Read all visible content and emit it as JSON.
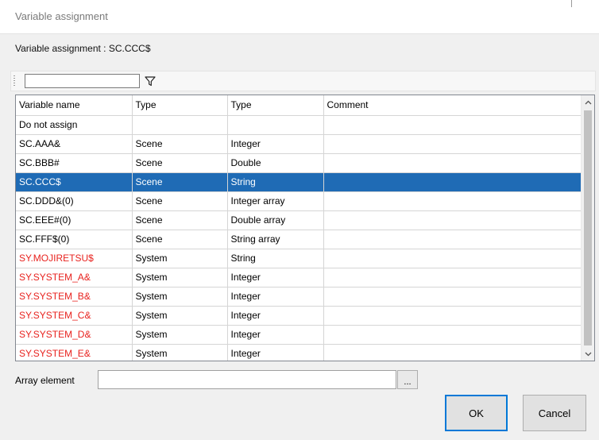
{
  "window": {
    "title": "Variable assignment"
  },
  "assignment": {
    "label": "Variable assignment : SC.CCC$"
  },
  "filter": {
    "value": "",
    "icon": "filter-icon"
  },
  "grid": {
    "columns": [
      "Variable name",
      "Type",
      "Type",
      "Comment"
    ],
    "rows": [
      {
        "name": "Do not assign",
        "scope": "",
        "type": "",
        "comment": ""
      },
      {
        "name": "SC.AAA&",
        "scope": "Scene",
        "type": "Integer",
        "comment": ""
      },
      {
        "name": "SC.BBB#",
        "scope": "Scene",
        "type": "Double",
        "comment": ""
      },
      {
        "name": "SC.CCC$",
        "scope": "Scene",
        "type": "String",
        "comment": ""
      },
      {
        "name": "SC.DDD&(0)",
        "scope": "Scene",
        "type": "Integer array",
        "comment": ""
      },
      {
        "name": "SC.EEE#(0)",
        "scope": "Scene",
        "type": "Double array",
        "comment": ""
      },
      {
        "name": "SC.FFF$(0)",
        "scope": "Scene",
        "type": "String array",
        "comment": ""
      },
      {
        "name": "SY.MOJIRETSU$",
        "scope": "System",
        "type": "String",
        "comment": ""
      },
      {
        "name": "SY.SYSTEM_A&",
        "scope": "System",
        "type": "Integer",
        "comment": ""
      },
      {
        "name": "SY.SYSTEM_B&",
        "scope": "System",
        "type": "Integer",
        "comment": ""
      },
      {
        "name": "SY.SYSTEM_C&",
        "scope": "System",
        "type": "Integer",
        "comment": ""
      },
      {
        "name": "SY.SYSTEM_D&",
        "scope": "System",
        "type": "Integer",
        "comment": ""
      },
      {
        "name": "SY.SYSTEM_E&",
        "scope": "System",
        "type": "Integer",
        "comment": ""
      }
    ],
    "selected_index": 3,
    "colors": {
      "selection": "#1f6bb5",
      "system_variable": "#e8221e"
    }
  },
  "array_element": {
    "label": "Array element",
    "value": "",
    "browse_label": "..."
  },
  "buttons": {
    "ok": "OK",
    "cancel": "Cancel"
  }
}
